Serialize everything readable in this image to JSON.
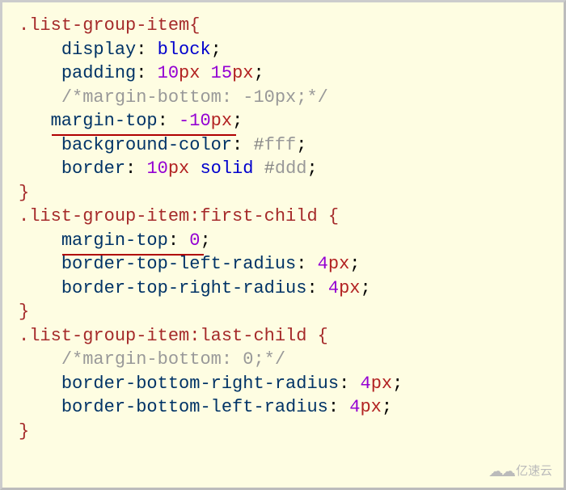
{
  "rules": [
    {
      "selector": ".list-group-item",
      "open": "{",
      "decls": [
        {
          "prop": "display",
          "value_kw": "block",
          "indent": 4
        },
        {
          "prop": "padding",
          "num1": "10",
          "unit1": "px",
          "num2": "15",
          "unit2": "px",
          "indent": 4
        },
        {
          "comment": "/*margin-bottom: -10px;*/",
          "indent": 4
        },
        {
          "prop": "margin-top",
          "num1": "-10",
          "unit1": "px",
          "indent": 3,
          "underline": true
        },
        {
          "prop": "background-color",
          "hex": "#fff",
          "indent": 4
        },
        {
          "prop": "border",
          "num1": "10",
          "unit1": "px",
          "kw1": "solid",
          "hex": "#ddd",
          "indent": 4
        }
      ],
      "close": "}"
    },
    {
      "selector": ".list-group-item:first-child ",
      "open": "{",
      "decls": [
        {
          "prop": "margin-top",
          "num1": "0",
          "indent": 4,
          "underline": true
        },
        {
          "prop": "border-top-left-radius",
          "num1": "4",
          "unit1": "px",
          "indent": 4
        },
        {
          "prop": "border-top-right-radius",
          "num1": "4",
          "unit1": "px",
          "indent": 4
        }
      ],
      "close": "}"
    },
    {
      "selector": ".list-group-item:last-child ",
      "open": "{",
      "decls": [
        {
          "comment": "/*margin-bottom: 0;*/",
          "indent": 4
        },
        {
          "prop": "border-bottom-right-radius",
          "num1": "4",
          "unit1": "px",
          "indent": 4
        },
        {
          "prop": "border-bottom-left-radius",
          "num1": "4",
          "unit1": "px",
          "indent": 4
        }
      ],
      "close": "}"
    }
  ],
  "watermark": "亿速云"
}
